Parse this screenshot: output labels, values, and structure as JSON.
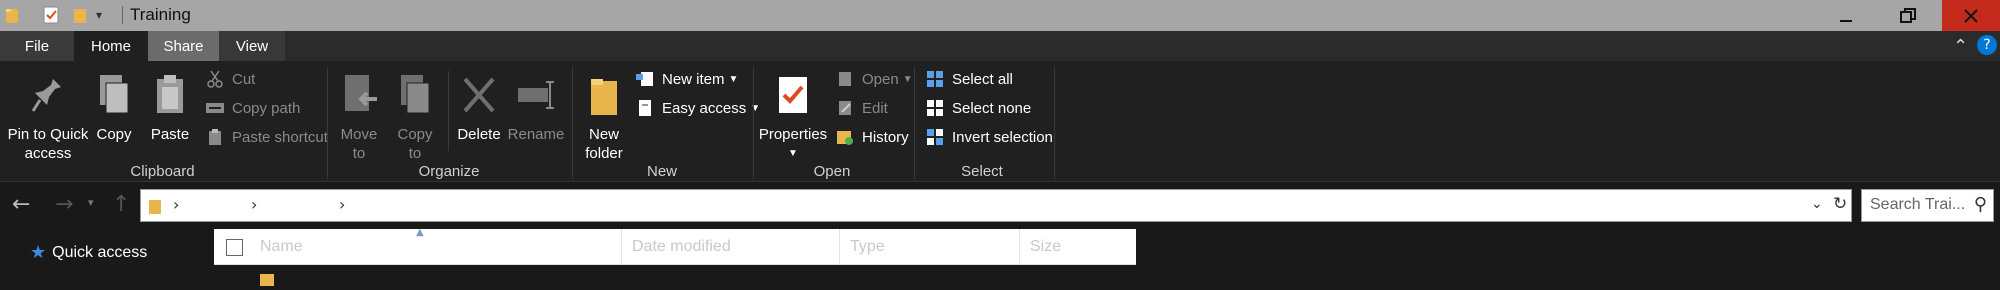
{
  "window": {
    "title": "Training"
  },
  "tabs": [
    "File",
    "Home",
    "Share",
    "View"
  ],
  "ribbon": {
    "clipboard": {
      "label": "Clipboard",
      "pin_line1": "Pin to Quick",
      "pin_line2": "access",
      "copy": "Copy",
      "paste": "Paste",
      "cut": "Cut",
      "copy_path": "Copy path",
      "paste_shortcut": "Paste shortcut"
    },
    "organize": {
      "label": "Organize",
      "move_to_1": "Move",
      "move_to_2": "to",
      "copy_to_1": "Copy",
      "copy_to_2": "to",
      "delete": "Delete",
      "rename": "Rename"
    },
    "new": {
      "label": "New",
      "new_folder_1": "New",
      "new_folder_2": "folder",
      "new_item": "New item",
      "easy_access": "Easy access"
    },
    "open": {
      "label": "Open",
      "properties": "Properties",
      "open": "Open",
      "edit": "Edit",
      "history": "History"
    },
    "select": {
      "label": "Select",
      "select_all": "Select all",
      "select_none": "Select none",
      "invert": "Invert selection"
    }
  },
  "search": {
    "placeholder": "Search Trai..."
  },
  "columns": [
    "Name",
    "Date modified",
    "Type",
    "Size"
  ],
  "nav": {
    "quick_access": "Quick access"
  },
  "colors": {
    "accent": "#0078d7",
    "folder": "#e8b64a",
    "close": "#c42b1c"
  }
}
